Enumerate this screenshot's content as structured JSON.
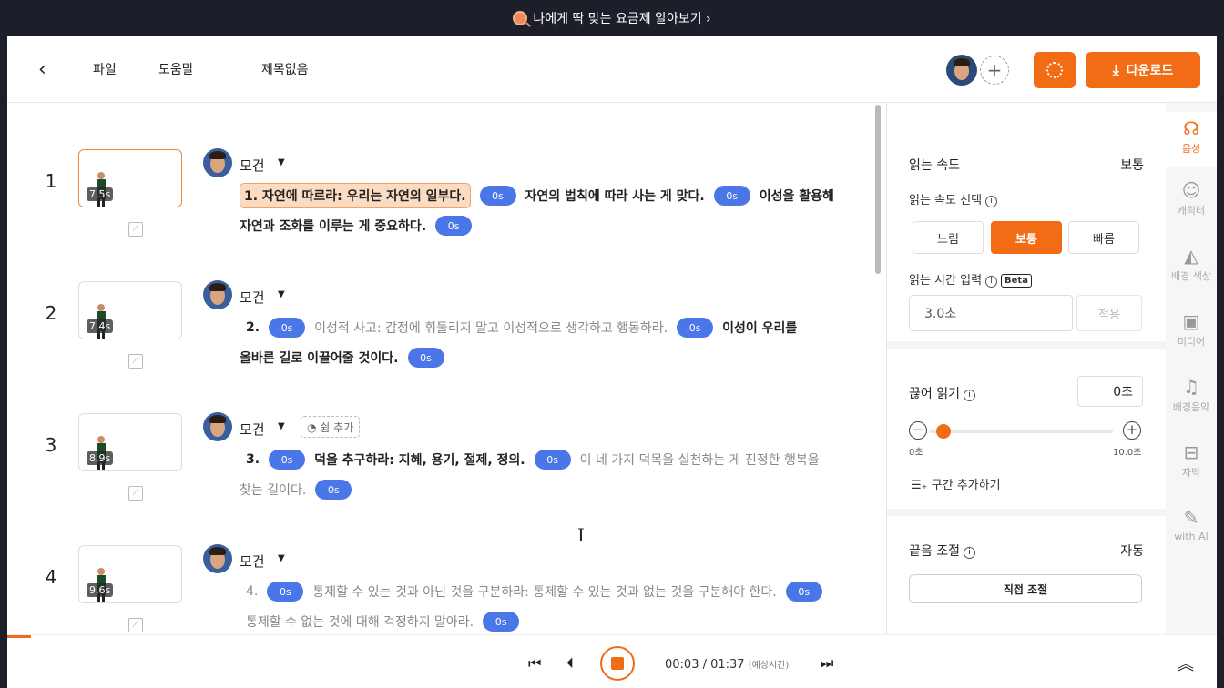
{
  "banner": {
    "text": "나에게 딱 맞는 요금제 알아보기 ›"
  },
  "header": {
    "menu_file": "파일",
    "menu_help": "도움말",
    "title": "제목없음",
    "add_collab": "+",
    "download": "다운로드"
  },
  "rows": [
    {
      "num": "1",
      "duration": "7.5s",
      "speaker": "모건",
      "line1": {
        "highlight": "1. 자연에 따르라: 우리는 자연의 일부다.",
        "pill1": "0s",
        "text2": "자연의 법칙에 따라 사는 게 맞다.",
        "pill2": "0s",
        "text3": "이성을 활용해"
      },
      "line2": {
        "text1": "자연과 조화를 이루는 게 중요하다.",
        "pill1": "0s"
      }
    },
    {
      "num": "2",
      "duration": "7.4s",
      "speaker": "모건",
      "line1": {
        "prefix": "2.",
        "pill1": "0s",
        "gray": "이성적 사고: 감정에 휘둘리지 말고 이성적으로 생각하고 행동하라.",
        "pill2": "0s",
        "bold": "이성이 우리를"
      },
      "line2": {
        "bold": "올바른 길로 이끌어줄 것이다.",
        "pill1": "0s"
      }
    },
    {
      "num": "3",
      "duration": "8.9s",
      "speaker": "모건",
      "rest": "쉼 추가",
      "line1": {
        "prefix": "3.",
        "pill1": "0s",
        "bold": "덕을 추구하라: 지혜, 용기, 절제, 정의.",
        "pill2": "0s",
        "gray": "이 네 가지 덕목을 실천하는 게 진정한 행복을"
      },
      "line2": {
        "gray": "찾는 길이다.",
        "pill1": "0s"
      }
    },
    {
      "num": "4",
      "duration": "9.6s",
      "speaker": "모건",
      "line1": {
        "prefix": "4.",
        "pill1": "0s",
        "gray": "통제할 수 있는 것과 아닌 것을 구분하라: 통제할 수 있는 것과 없는 것을 구분해야 한다.",
        "pill2": "0s"
      },
      "line2": {
        "gray": "통제할 수 없는 것에 대해 걱정하지 말아라.",
        "pill1": "0s"
      }
    }
  ],
  "panel": {
    "speed_label": "읽는 속도",
    "speed_value": "보통",
    "speed_select": "읽는 속도 선택",
    "seg_slow": "느림",
    "seg_normal": "보통",
    "seg_fast": "빠름",
    "time_input_label": "읽는 시간 입력",
    "beta": "Beta",
    "time_value": "3.0초",
    "apply": "적용",
    "break_label": "끊어 읽기",
    "break_value": "0초",
    "slider_min": "0초",
    "slider_max": "10.0초",
    "slider_value_fraction": 0.0,
    "add_section": "구간 추가하기",
    "ending_label": "끝음 조절",
    "ending_value": "자동",
    "manual": "직접 조절"
  },
  "rail": [
    {
      "label": "음성",
      "icon": "voice-icon"
    },
    {
      "label": "캐릭터",
      "icon": "character-icon"
    },
    {
      "label": "배경 색상",
      "icon": "paint-bucket-icon"
    },
    {
      "label": "미디어",
      "icon": "image-icon"
    },
    {
      "label": "배경음악",
      "icon": "music-icon"
    },
    {
      "label": "자막",
      "icon": "cc-icon"
    },
    {
      "label": "with AI",
      "icon": "ai-pen-icon"
    }
  ],
  "player": {
    "current": "00:03 / 01:37",
    "estimate": "(예상시간)"
  },
  "colors": {
    "accent": "#f26c15",
    "pill": "#4a76e8"
  }
}
